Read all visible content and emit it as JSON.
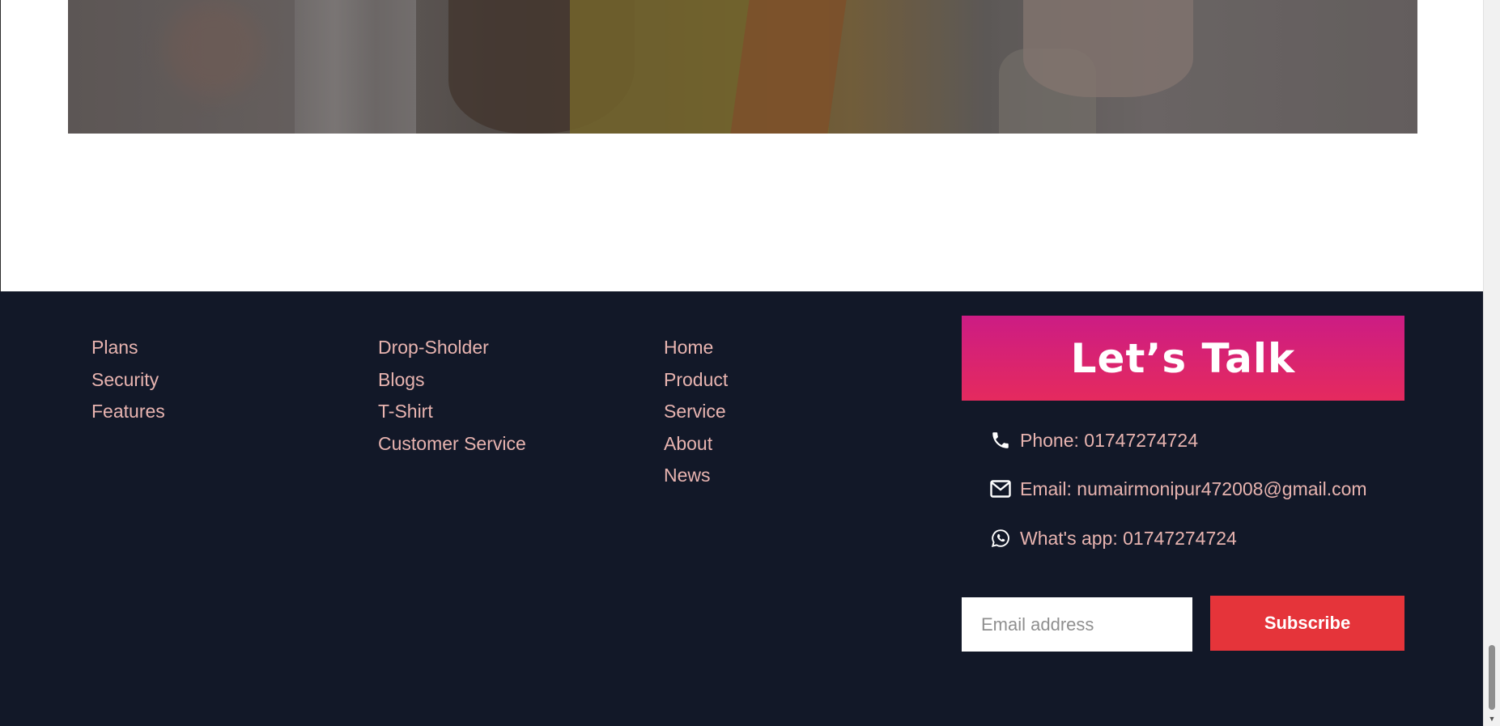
{
  "footer": {
    "columns": [
      {
        "links": [
          "Plans",
          "Security",
          "Features"
        ]
      },
      {
        "links": [
          "Drop-Sholder",
          "Blogs",
          "T-Shirt",
          "Customer Service"
        ]
      },
      {
        "links": [
          "Home",
          "Product",
          "Service",
          "About",
          "News"
        ]
      }
    ],
    "talk": {
      "title": "Let’s Talk"
    },
    "contact": {
      "phone": "Phone: 01747274724",
      "email": "Email: numairmonipur472008@gmail.com",
      "whatsapp": "What's app: 01747274724"
    },
    "newsletter": {
      "placeholder": "Email address",
      "button_label": "Subscribe"
    }
  },
  "colors": {
    "footer_bg": "#121828",
    "link_text": "#e8b4b0",
    "talk_gradient_top": "#cc1c84",
    "talk_gradient_bottom": "#e52a5e",
    "subscribe_bg": "#e5343a"
  },
  "icons": {
    "phone": "phone-icon",
    "email": "envelope-icon",
    "whatsapp": "whatsapp-icon"
  }
}
